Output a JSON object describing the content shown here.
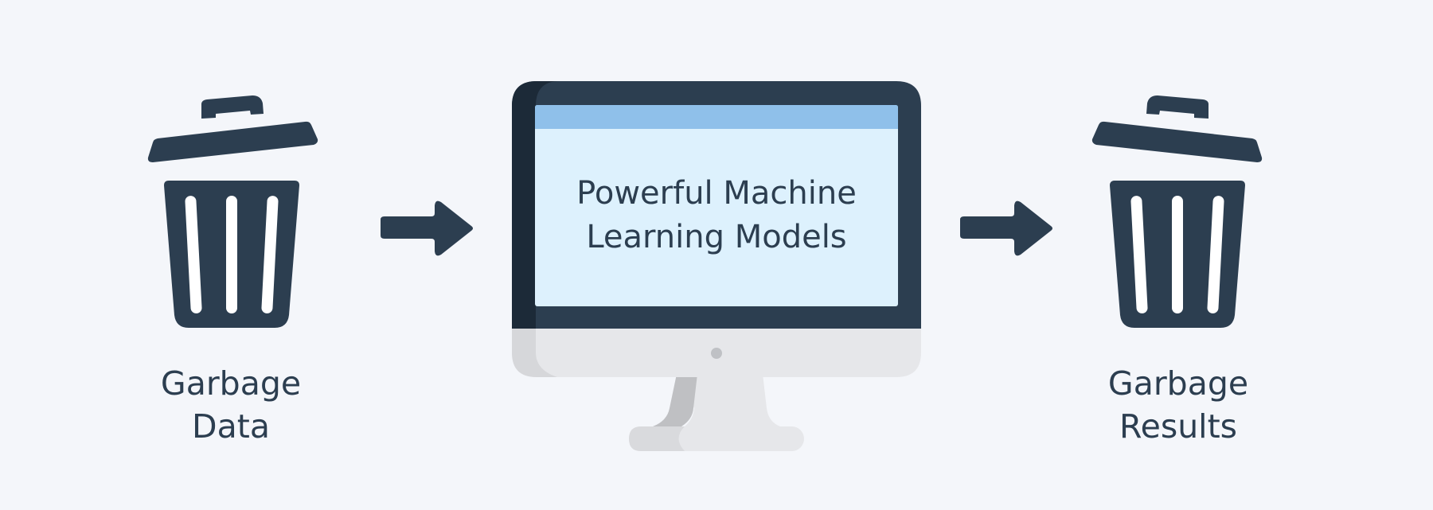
{
  "left_bin": {
    "label_line1": "Garbage",
    "label_line2": "Data",
    "icon": "trash-can-icon"
  },
  "monitor": {
    "line1": "Powerful Machine",
    "line2": "Learning Models",
    "icon": "desktop-monitor-icon"
  },
  "right_bin": {
    "label_line1": "Garbage",
    "label_line2": "Results",
    "icon": "trash-can-icon"
  },
  "arrows": {
    "icon": "arrow-right-icon"
  },
  "colors": {
    "background": "#f4f6fa",
    "dark": "#2c3e50",
    "screen_bar": "#8fc0ea",
    "screen_fill": "#ddf1fd",
    "stand": "#e6e7ea"
  }
}
